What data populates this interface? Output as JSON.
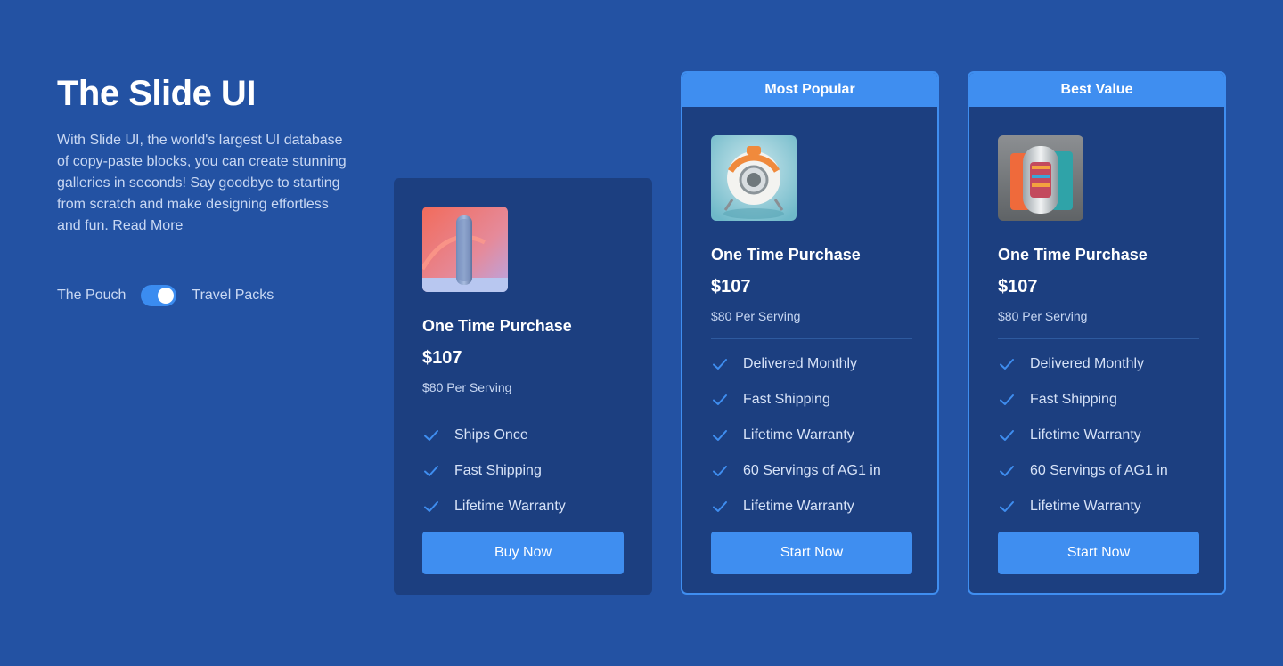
{
  "intro": {
    "title": "The Slide UI",
    "description": "With Slide UI, the world's largest UI database of copy-paste blocks, you can create stunning galleries in seconds! Say goodbye to starting from scratch and make designing effortless and fun.  Read More"
  },
  "toggle": {
    "left_label": "The Pouch",
    "right_label": "Travel Packs",
    "state": "on"
  },
  "colors": {
    "background": "#2352a3",
    "card": "#1c3f80",
    "accent": "#3f8ef0"
  },
  "cards": [
    {
      "badge": "",
      "image_icon": "speaker-product-image",
      "title": "One Time Purchase",
      "price": "$107",
      "per_serving": "$80 Per Serving",
      "features": [
        "Ships Once",
        "Fast Shipping",
        "Lifetime Warranty"
      ],
      "button": "Buy Now"
    },
    {
      "badge": "Most Popular",
      "image_icon": "robot-product-image",
      "title": "One Time Purchase",
      "price": "$107",
      "per_serving": "$80 Per Serving",
      "features": [
        "Delivered Monthly",
        "Fast Shipping",
        "Lifetime Warranty",
        "60 Servings of AG1 in",
        "Lifetime Warranty"
      ],
      "button": "Start Now"
    },
    {
      "badge": "Best Value",
      "image_icon": "capsule-product-image",
      "title": "One Time Purchase",
      "price": "$107",
      "per_serving": "$80 Per Serving",
      "features": [
        "Delivered Monthly",
        "Fast Shipping",
        "Lifetime Warranty",
        "60 Servings of AG1 in",
        "Lifetime Warranty"
      ],
      "button": "Start Now"
    }
  ]
}
